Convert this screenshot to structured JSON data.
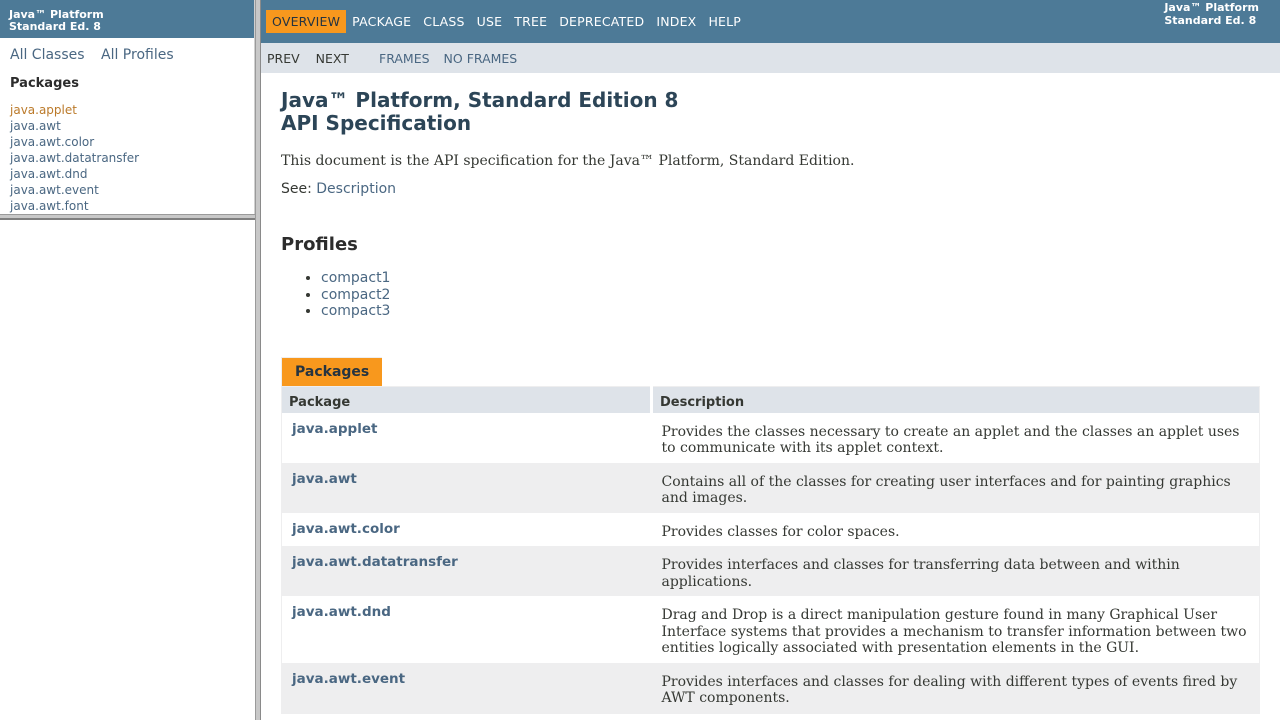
{
  "left": {
    "header_line1": "Java™ Platform",
    "header_line2": "Standard Ed. 8",
    "all_classes": "All Classes",
    "all_profiles": "All Profiles",
    "packages_title": "Packages",
    "packages": [
      "java.applet",
      "java.awt",
      "java.awt.color",
      "java.awt.datatransfer",
      "java.awt.dnd",
      "java.awt.event",
      "java.awt.font"
    ]
  },
  "nav": {
    "items": [
      "Overview",
      "Package",
      "Class",
      "Use",
      "Tree",
      "Deprecated",
      "Index",
      "Help"
    ],
    "about_line1": "Java™ Platform",
    "about_line2": "Standard Ed. 8",
    "prev": "PREV",
    "next": "NEXT",
    "frames": "FRAMES",
    "no_frames": "NO FRAMES"
  },
  "main": {
    "title_line1": "Java™ Platform, Standard Edition 8",
    "title_line2": "API Specification",
    "intro": "This document is the API specification for the Java™ Platform, Standard Edition.",
    "see_label": "See: ",
    "see_link": "Description",
    "profiles_title": "Profiles",
    "profiles": [
      "compact1",
      "compact2",
      "compact3"
    ],
    "packages_tab": "Packages",
    "col_package": "Package",
    "col_description": "Description",
    "rows": [
      {
        "name": "java.applet",
        "desc": "Provides the classes necessary to create an applet and the classes an applet uses to communicate with its applet context."
      },
      {
        "name": "java.awt",
        "desc": "Contains all of the classes for creating user interfaces and for painting graphics and images."
      },
      {
        "name": "java.awt.color",
        "desc": "Provides classes for color spaces."
      },
      {
        "name": "java.awt.datatransfer",
        "desc": "Provides interfaces and classes for transferring data between and within applications."
      },
      {
        "name": "java.awt.dnd",
        "desc": "Drag and Drop is a direct manipulation gesture found in many Graphical User Interface systems that provides a mechanism to transfer information between two entities logically associated with presentation elements in the GUI."
      },
      {
        "name": "java.awt.event",
        "desc": "Provides interfaces and classes for dealing with different types of events fired by AWT components."
      }
    ]
  },
  "colors": {
    "header_blue": "#4d7a97",
    "accent_orange": "#f8981d",
    "link": "#4a6782",
    "subnav_bg": "#dee3e9",
    "row_alt": "#eeeeef"
  }
}
